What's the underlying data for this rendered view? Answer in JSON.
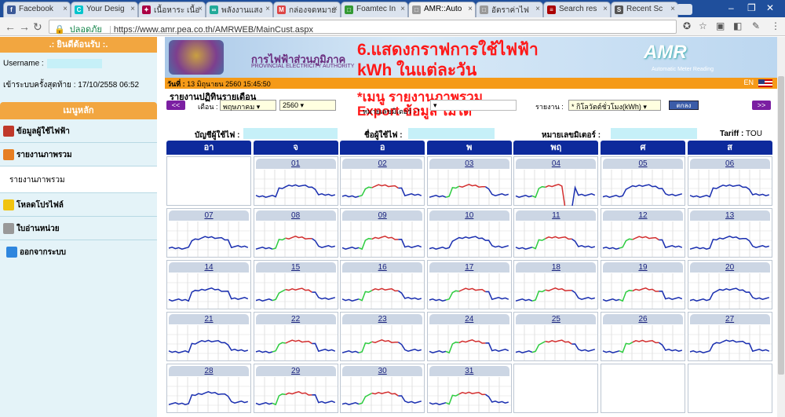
{
  "tabs": [
    {
      "title": "Facebook",
      "icon": "facebook-icon",
      "color": "#3b5998",
      "glyph": "f",
      "active": false
    },
    {
      "title": "Your Desig",
      "icon": "canva-icon",
      "color": "#00c4cc",
      "glyph": "C",
      "active": false
    },
    {
      "title": "เนื้อหาระ เนื้อ",
      "icon": "doc-icon",
      "color": "#a04",
      "glyph": "✦",
      "active": false
    },
    {
      "title": "พลังงานแสง",
      "icon": "link-icon",
      "color": "#2a9",
      "glyph": "∞",
      "active": false
    },
    {
      "title": "กล่องจดหมาย",
      "icon": "gmail-icon",
      "color": "#d44",
      "glyph": "M",
      "active": false
    },
    {
      "title": "Foamtec In",
      "icon": "page-icon",
      "color": "#393",
      "glyph": "□",
      "active": false
    },
    {
      "title": "AMR::Auto",
      "icon": "page-icon",
      "color": "#999",
      "glyph": "□",
      "active": true
    },
    {
      "title": "อัตราค่าไฟ",
      "icon": "page-icon",
      "color": "#999",
      "glyph": "□",
      "active": false
    },
    {
      "title": "Search res",
      "icon": "thai-flag-icon",
      "color": "#a00",
      "glyph": "≡",
      "active": false
    },
    {
      "title": "Recent Sc",
      "icon": "recent-icon",
      "color": "#555",
      "glyph": "S",
      "active": false
    }
  ],
  "address": {
    "secure_label": "ปลอดภัย",
    "url": "https://www.amr.pea.co.th/AMRWEB/MainCust.aspx"
  },
  "sidebar": {
    "welcome": ".: ยินดีต้อนรับ :.",
    "username_label": "Username :",
    "last_login_label": "เข้าระบบครั้งสุดท้าย :",
    "last_login_value": "17/10/2558 06:52",
    "menu_header": "เมนูหลัก",
    "items": [
      {
        "label": "ข้อมูลผู้ใช้ไฟฟ้า",
        "icon": "user-info-icon",
        "color": "#c0392b"
      },
      {
        "label": "รายงานภาพรวม",
        "icon": "report-icon",
        "color": "#e67e22"
      },
      {
        "label": "รายงานภาพรวม",
        "icon": "",
        "color": "",
        "sub": true
      },
      {
        "label": "โหลดโปรไฟล์",
        "icon": "lightning-icon",
        "color": "#f1c40f"
      },
      {
        "label": "ใบอ่านหน่วย",
        "icon": "mail-icon",
        "color": "#999"
      },
      {
        "label": "ออกจากระบบ",
        "icon": "power-icon",
        "color": "#2e86de"
      }
    ]
  },
  "banner": {
    "org_name": "การไฟฟ้าส่วนภูมิภาค",
    "org_sub": "PROVINCIAL ELECTRICITY AUTHORITY",
    "amr_logo": "AMR",
    "amr_sub": "Automatic Meter Reading",
    "overlay_line1": "6.แสดงกราฟการใช้ไฟฟ้า",
    "overlay_line2": "kWh ในแต่ละวัน"
  },
  "datebar": {
    "label": "วันที่ :",
    "value": "13 มิถุนายน 2560  15:45:50",
    "lang": "EN"
  },
  "report": {
    "title": "รายงานปฏิทินรายเดือน",
    "overlay_line1": "*เมนู รายงานภาพรวม",
    "overlay_line2": "Export ข้อมูล ไม่ได้",
    "prev": "<<",
    "next": ">>",
    "month_label": "เดือน :",
    "month_value": "พฤษภาคม",
    "year_value": "2560",
    "meter_label": "หมายเลขมิเตอร์ : *",
    "report_label": "รายงาน :",
    "report_value": "* กิโลวัตต์ชั่วโมง(kWh)",
    "ok": "ตกลง"
  },
  "info": {
    "account_label": "บัญชีผู้ใช้ไฟ :",
    "name_label": "ชื่อผู้ใช้ไฟ :",
    "meter_label": "หมายเลขมิเตอร์ :",
    "tariff_label": "Tariff :",
    "tariff_value": "TOU"
  },
  "calendar": {
    "weekdays": [
      "อา",
      "จ",
      "อ",
      "พ",
      "พฤ",
      "ศ",
      "ส"
    ],
    "days": [
      "01",
      "02",
      "03",
      "04",
      "05",
      "06",
      "07",
      "08",
      "09",
      "10",
      "11",
      "12",
      "13",
      "14",
      "15",
      "16",
      "17",
      "18",
      "19",
      "20",
      "21",
      "22",
      "23",
      "24",
      "25",
      "26",
      "27",
      "28",
      "29",
      "30",
      "31"
    ],
    "first_weekday": 1,
    "colors": {
      "blue": "#1a2fb0",
      "green": "#2ecc40",
      "red": "#d32f2f"
    },
    "day_color_pattern": {
      "01": "blue",
      "02": "mix",
      "03": "mix",
      "04": "mix",
      "05": "blue",
      "06": "blue",
      "07": "blue",
      "08": "mix",
      "09": "mix",
      "10": "blue",
      "11": "mix",
      "12": "mix",
      "13": "blue",
      "14": "blue",
      "15": "mix",
      "16": "mix",
      "17": "mix",
      "18": "mix",
      "19": "mix",
      "20": "blue",
      "21": "blue",
      "22": "mix",
      "23": "mix",
      "24": "mix",
      "25": "mix",
      "26": "mix",
      "27": "blue",
      "28": "blue",
      "29": "mix",
      "30": "mix",
      "31": "mix"
    }
  }
}
